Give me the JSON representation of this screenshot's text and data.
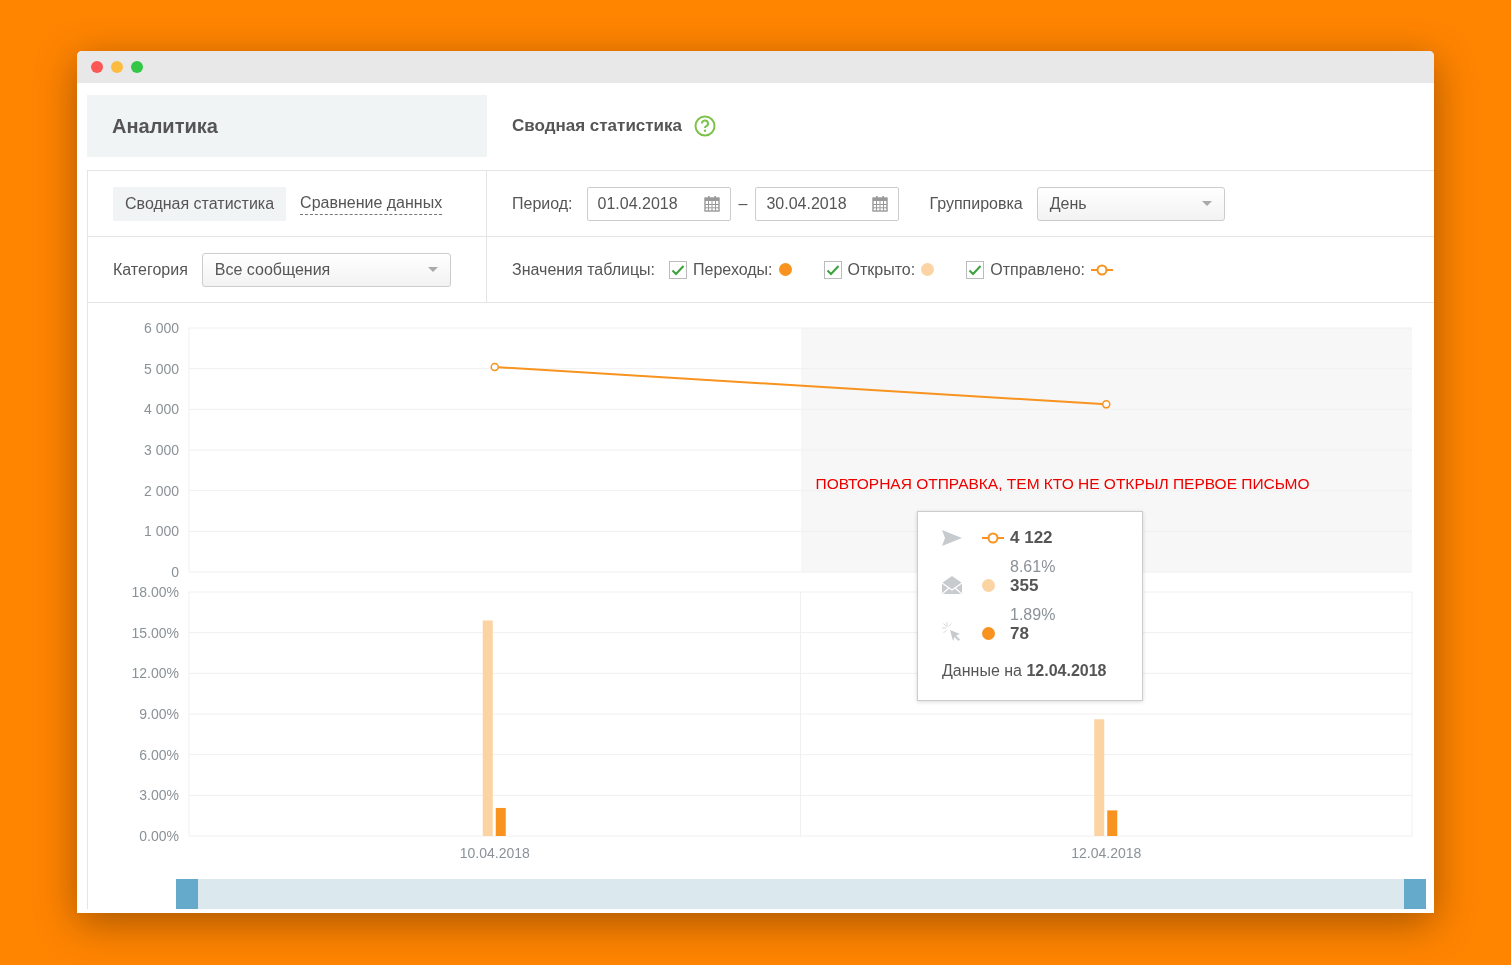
{
  "sidebar": {
    "title": "Аналитика",
    "tabs": [
      {
        "label": "Сводная статистика",
        "selected": true
      },
      {
        "label": "Сравнение данных",
        "selected": false
      }
    ],
    "category": {
      "label": "Категория",
      "value": "Все сообщения"
    }
  },
  "header": {
    "title": "Сводная статистика"
  },
  "filters": {
    "period_label": "Период:",
    "date_from": "01.04.2018",
    "separator": "–",
    "date_to": "30.04.2018",
    "grouping_label": "Группировка",
    "grouping_value": "День"
  },
  "table_values": {
    "label": "Значения таблицы:",
    "items": [
      {
        "label": "Переходы:",
        "checked": true,
        "color": "#f7931e",
        "kind": "dot"
      },
      {
        "label": "Открыто:",
        "checked": true,
        "color": "#fcd3a3",
        "kind": "dot"
      },
      {
        "label": "Отправлено:",
        "checked": true,
        "color": "#f7931e",
        "kind": "line"
      }
    ]
  },
  "line_chart": {
    "chart_data": {
      "type": "line",
      "grid": true,
      "series": [
        {
          "color": "#f7931e",
          "marker": "circle",
          "values": [
            5040,
            4122
          ]
        }
      ],
      "ylim": [
        0,
        6000
      ],
      "yticks": [
        {
          "value": 0,
          "label": "0"
        },
        {
          "value": 1000,
          "label": "1 000"
        },
        {
          "value": 2000,
          "label": "2 000"
        },
        {
          "value": 3000,
          "label": "3 000"
        },
        {
          "value": 4000,
          "label": "4 000"
        },
        {
          "value": 5000,
          "label": "5 000"
        },
        {
          "value": 6000,
          "label": "6 000"
        }
      ],
      "annotations": [
        "ПОВТОРНАЯ ОТПРАВКА, ТЕМ КТО НЕ ОТКРЫЛ ПЕРВОЕ ПИСЬМО"
      ]
    }
  },
  "bar_chart": {
    "chart_data": {
      "type": "bar",
      "grid": true,
      "categories": [
        "10.04.2018",
        "12.04.2018"
      ],
      "series": [
        {
          "color": "#fcd3a3",
          "values": [
            15.9,
            8.61
          ]
        },
        {
          "color": "#f7931e",
          "values": [
            2.07,
            1.89
          ]
        }
      ],
      "ylim": [
        0,
        18
      ],
      "yticks": [
        {
          "value": 0,
          "label": "0.00%"
        },
        {
          "value": 3,
          "label": "3.00%"
        },
        {
          "value": 6,
          "label": "6.00%"
        },
        {
          "value": 9,
          "label": "9.00%"
        },
        {
          "value": 12,
          "label": "12.00%"
        },
        {
          "value": 15,
          "label": "15.00%"
        },
        {
          "value": 18,
          "label": "18.00%"
        }
      ]
    }
  },
  "tooltip": {
    "rows": [
      {
        "kind": "sent",
        "color": "#f7931e",
        "value": "4 122"
      },
      {
        "kind": "opened",
        "color": "#fcd3a3",
        "percent": "8.61%",
        "value": "355"
      },
      {
        "kind": "clicks",
        "color": "#f7931e",
        "percent": "1.89%",
        "value": "78"
      }
    ],
    "footer": "Данные на **12.04.2018**"
  }
}
